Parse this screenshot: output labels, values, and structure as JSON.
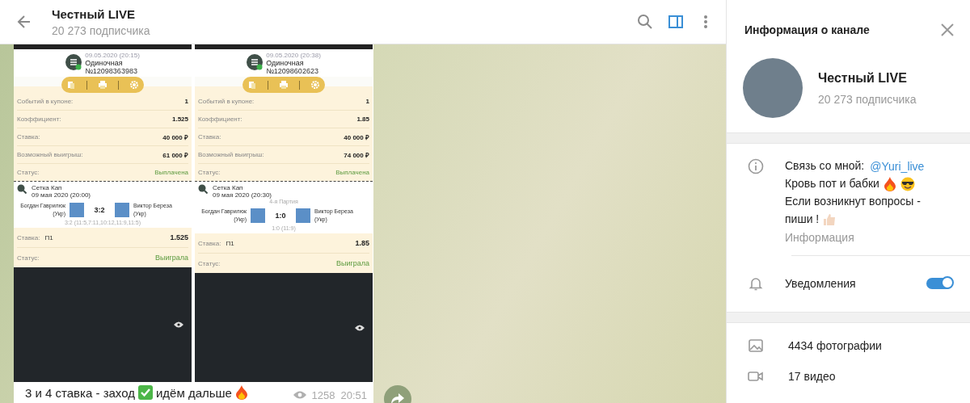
{
  "header": {
    "title": "Честный LIVE",
    "subtitle": "20 273 подписчика",
    "panel_toggle": {
      "selected": true
    }
  },
  "message": {
    "slips": [
      {
        "date": "09.05.2020 (20:15)",
        "type": "Одиночная",
        "number": "№12098363983",
        "rows": [
          {
            "label": "Событий в купоне:",
            "value": "1",
            "kind": "value"
          },
          {
            "label": "Коэффициент:",
            "value": "1.525",
            "kind": "value"
          },
          {
            "label": "Ставка:",
            "value": "40 000 ₽",
            "kind": "value"
          },
          {
            "label": "Возможный выигрыш:",
            "value": "61 000 ₽",
            "kind": "value"
          },
          {
            "label": "Статус:",
            "value": "Выплачена",
            "kind": "status"
          }
        ],
        "event": {
          "tournament": "Сетка Кап",
          "datetime": "09 мая 2020 (20:00)",
          "player1": "Богдан Гаврилюк (Укр)",
          "player2": "Виктор Береза (Укр)",
          "score": "3:2",
          "detail": "3:2 (11:5,7:11,10:12,11:9,11:5)"
        },
        "stake_rows": [
          {
            "label": "Ставка:",
            "pick": "П1",
            "value": "1.525",
            "kind": "value"
          },
          {
            "label": "Статус:",
            "value": "Выиграла",
            "kind": "status"
          }
        ]
      },
      {
        "date": "09.05.2020 (20:38)",
        "type": "Одиночная",
        "number": "№12098602623",
        "rows": [
          {
            "label": "Событий в купоне:",
            "value": "1",
            "kind": "value"
          },
          {
            "label": "Коэффициент:",
            "value": "1.85",
            "kind": "value"
          },
          {
            "label": "Ставка:",
            "value": "40 000 ₽",
            "kind": "value"
          },
          {
            "label": "Возможный выигрыш:",
            "value": "74 000 ₽",
            "kind": "value"
          },
          {
            "label": "Статус:",
            "value": "Выплачена",
            "kind": "status"
          }
        ],
        "event": {
          "tournament": "Сетка Кап",
          "datetime": "09 мая 2020 (20:30)",
          "stage": "4-я Партия",
          "player1": "Богдан Гаврилюк (Укр)",
          "player2": "Виктор Береза (Укр)",
          "score": "1:0",
          "detail": "1:0 (11:9)"
        },
        "stake_rows": [
          {
            "label": "Ставка:",
            "pick": "П1",
            "value": "1.85",
            "kind": "value"
          },
          {
            "label": "Статус:",
            "value": "Выиграла",
            "kind": "status"
          }
        ]
      }
    ],
    "caption": {
      "before": "3 и 4 ставка - заход",
      "after": "идём дальше"
    },
    "views": "1258",
    "time": "20:51"
  },
  "panel": {
    "title": "Информация о канале",
    "name": "Честный LIVE",
    "subscribers": "20 273 подписчика",
    "contact_label": "Связь со мной:",
    "contact_link": "@Yuri_live",
    "line_2": "Кровь пот и бабки",
    "line_3": "Если возникнут вопросы -",
    "line_4": "пиши !",
    "info_label": "Информация",
    "notifications": {
      "label": "Уведомления",
      "on": true
    },
    "media": [
      {
        "kind": "photos",
        "label": "4434 фотографии"
      },
      {
        "kind": "video",
        "label": "17 видео"
      }
    ]
  }
}
